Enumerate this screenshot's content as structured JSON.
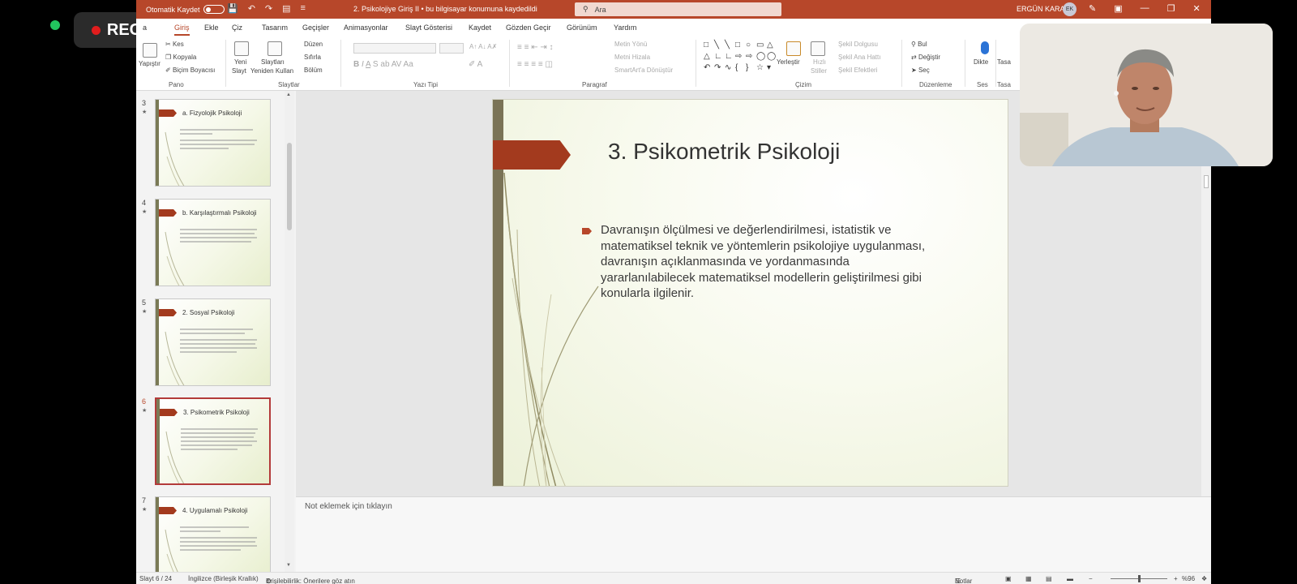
{
  "recording": {
    "label": "REC"
  },
  "titlebar": {
    "autosave_label": "Otomatik Kaydet",
    "doc_title": "2. Psikolojiye Giriş II  •  bu bilgisayar konumuna kaydedildi",
    "search_placeholder": "Ara",
    "user_name": "ERGÜN KARA",
    "user_initials": "EK"
  },
  "menu": {
    "items": [
      "Dosya",
      "Giriş",
      "Ekle",
      "Çiz",
      "Tasarım",
      "Geçişler",
      "Animasyonlar",
      "Slayt Gösterisi",
      "Kaydet",
      "Gözden Geçir",
      "Görünüm",
      "Yardım"
    ],
    "visible_first": "a",
    "active": "Giriş"
  },
  "ribbon": {
    "pano": {
      "label": "Pano",
      "paste": "Yapıştır",
      "cut": "Kes",
      "copy": "Kopyala",
      "format_painter": "Biçim Boyacısı"
    },
    "slaytlar": {
      "label": "Slaytlar",
      "new_slide_1": "Yeni",
      "new_slide_2": "Slayt",
      "reuse_1": "Slaytları",
      "reuse_2": "Yeniden Kullan",
      "layout": "Düzen",
      "reset": "Sıfırla",
      "section": "Bölüm"
    },
    "yazi_tipi": {
      "label": "Yazı Tipi"
    },
    "paragraf": {
      "label": "Paragraf",
      "text_direction": "Metin Yönü",
      "align_text": "Metni Hizala",
      "smartart": "SmartArt'a Dönüştür"
    },
    "cizim": {
      "label": "Çizim",
      "arrange": "Yerleştir",
      "quick_styles_1": "Hızlı",
      "quick_styles_2": "Stiller",
      "shape_fill": "Şekil Dolgusu",
      "shape_outline": "Şekil Ana Hattı",
      "shape_effects": "Şekil Efektleri"
    },
    "duzenleme": {
      "label": "Düzenleme",
      "find": "Bul",
      "replace": "Değiştir",
      "select": "Seç"
    },
    "ses": {
      "label": "Ses",
      "dictate": "Dikte"
    },
    "tasarimci": {
      "label": "Tasa",
      "button": "Tasa"
    }
  },
  "thumbnails": [
    {
      "number": "3",
      "title": "a. Fizyolojik Psikoloji"
    },
    {
      "number": "4",
      "title": "b. Karşılaştırmalı Psikoloji"
    },
    {
      "number": "5",
      "title": "2. Sosyal Psikoloji"
    },
    {
      "number": "6",
      "title": "3. Psikometrik Psikoloji"
    },
    {
      "number": "7",
      "title": "4. Uygulamalı Psikoloji"
    }
  ],
  "slide": {
    "title": "3. Psikometrik Psikoloji",
    "body": "Davranışın ölçülmesi ve değerlendirilmesi, istatistik ve matematiksel teknik ve yöntemlerin psikolojiye uygulanması, davranışın açıklanmasında ve yordanmasında yararlanılabilecek matematiksel modellerin geliştirilmesi gibi konularla ilgilenir."
  },
  "notes": {
    "placeholder": "Not eklemek için tıklayın"
  },
  "statusbar": {
    "slide_counter": "Slayt 6 / 24",
    "language": "İngilizce (Birleşik Krallık)",
    "accessibility": "Erişilebilirlik: Önerilere göz atın",
    "notes_button": "Notlar",
    "zoom": "%96"
  },
  "colors": {
    "accent": "#b7472a",
    "slide_flag": "#a33a1e",
    "slide_bar": "#7a7356"
  }
}
